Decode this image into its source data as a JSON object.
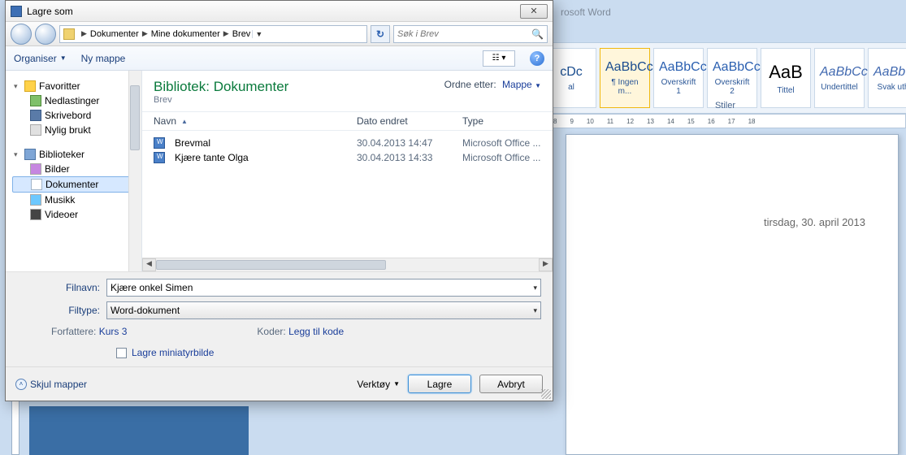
{
  "word": {
    "title": "rosoft Word",
    "styles_label": "Stiler",
    "styles": [
      {
        "preview": "cDc",
        "label": "al"
      },
      {
        "preview": "AaBbCcDc",
        "label": "¶ Ingen m..."
      },
      {
        "preview": "AaBbCc",
        "label": "Overskrift 1"
      },
      {
        "preview": "AaBbCc",
        "label": "Overskrift 2"
      },
      {
        "preview": "AaB",
        "label": "Tittel"
      },
      {
        "preview": "AaBbCc.",
        "label": "Undertittel"
      },
      {
        "preview": "AaBbC",
        "label": "Svak uth"
      }
    ],
    "ruler_numbers": [
      "8",
      "9",
      "10",
      "11",
      "12",
      "13",
      "14",
      "15",
      "16",
      "17",
      "18"
    ],
    "page_text": "tirsdag, 30. april 2013"
  },
  "dialog": {
    "title": "Lagre som",
    "breadcrumb": [
      "Dokumenter",
      "Mine dokumenter",
      "Brev"
    ],
    "search_placeholder": "Søk i Brev",
    "toolbar": {
      "organize": "Organiser",
      "new_folder": "Ny mappe"
    },
    "sidebar": {
      "favorites": "Favoritter",
      "downloads": "Nedlastinger",
      "desktop": "Skrivebord",
      "recent": "Nylig brukt",
      "libraries": "Biblioteker",
      "pictures": "Bilder",
      "documents": "Dokumenter",
      "music": "Musikk",
      "videos": "Videoer"
    },
    "library": {
      "prefix": "Bibliotek:",
      "name": "Dokumenter",
      "sub": "Brev",
      "sort_label": "Ordne etter:",
      "sort_value": "Mappe"
    },
    "columns": {
      "name": "Navn",
      "date": "Dato endret",
      "type": "Type"
    },
    "files": [
      {
        "name": "Brevmal",
        "date": "30.04.2013 14:47",
        "type": "Microsoft Office ..."
      },
      {
        "name": "Kjære tante Olga",
        "date": "30.04.2013 14:33",
        "type": "Microsoft Office ..."
      }
    ],
    "form": {
      "filename_label": "Filnavn:",
      "filename_value": "Kjære onkel Simen",
      "filetype_label": "Filtype:",
      "filetype_value": "Word-dokument",
      "authors_label": "Forfattere:",
      "authors_value": "Kurs 3",
      "tags_label": "Koder:",
      "tags_value": "Legg til kode",
      "thumb_label": "Lagre miniatyrbilde"
    },
    "footer": {
      "hide": "Skjul mapper",
      "tools": "Verktøy",
      "save": "Lagre",
      "cancel": "Avbryt"
    }
  }
}
